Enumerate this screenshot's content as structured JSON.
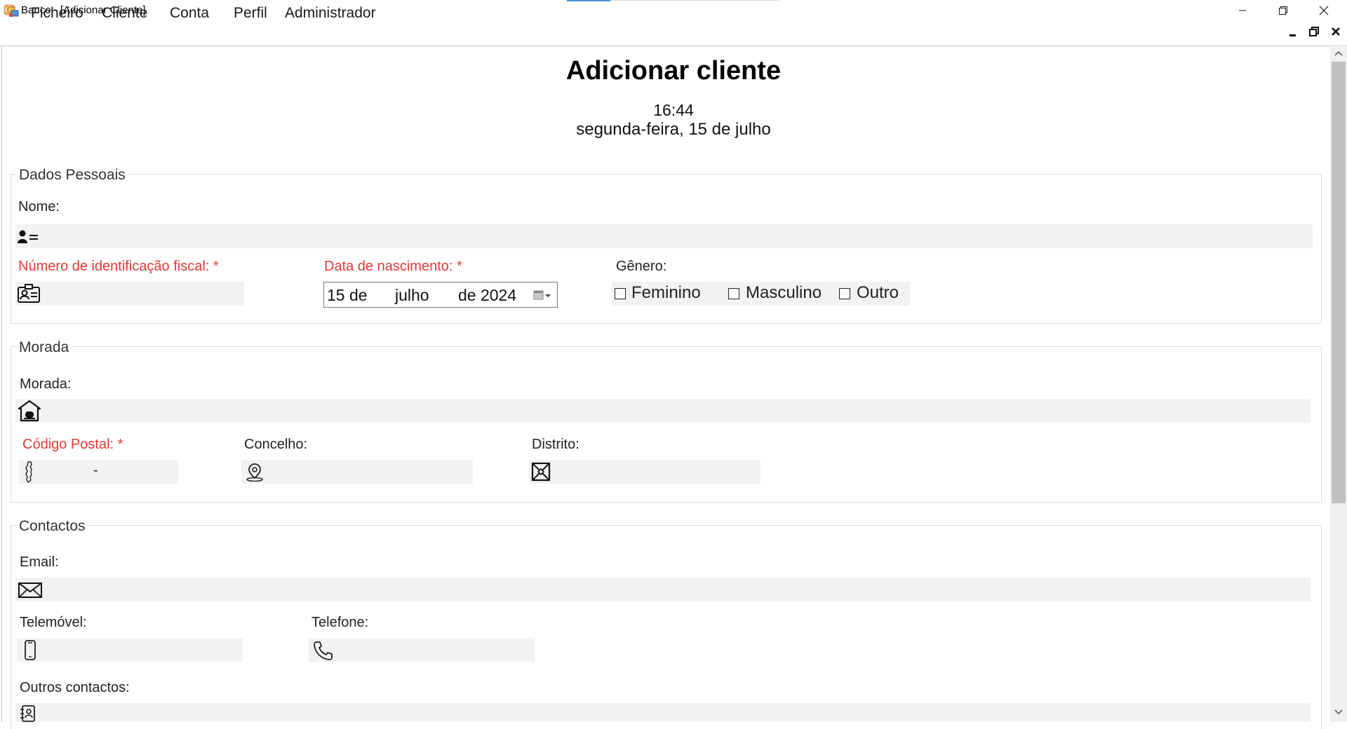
{
  "window": {
    "title": "Banco - [Adicionar Cliente]",
    "controls": [
      "minimize-icon",
      "restore-icon",
      "close-icon"
    ]
  },
  "menu": {
    "items": [
      "Ficheiro",
      "Cliente",
      "Conta",
      "Perfil",
      "Administrador"
    ],
    "mdi_controls": [
      "minimize-icon",
      "restore-icon",
      "close-icon"
    ]
  },
  "header": {
    "title": "Adicionar cliente",
    "time": "16:44",
    "date": "segunda-feira, 15 de julho"
  },
  "dados_pessoais": {
    "legend": "Dados Pessoais",
    "nome_label": "Nome:",
    "nome_value": "",
    "nif_label": "Número de identificação fiscal: *",
    "nif_value": "",
    "dob_label": "Data de nascimento: *",
    "dob_day": "15 de",
    "dob_month": "julho",
    "dob_year": "de 2024",
    "genero_label": "Gênero:",
    "genero_options": [
      "Feminino",
      "Masculino",
      "Outro"
    ]
  },
  "morada": {
    "legend": "Morada",
    "morada_label": "Morada:",
    "morada_value": "",
    "codigo_postal_label": "Código Postal: *",
    "codigo_postal_sep": "-",
    "concelho_label": "Concelho:",
    "concelho_value": "",
    "distrito_label": "Distrito:",
    "distrito_value": ""
  },
  "contactos": {
    "legend": "Contactos",
    "email_label": "Email:",
    "email_value": "",
    "telemovel_label": "Telemóvel:",
    "telemovel_value": "",
    "telefone_label": "Telefone:",
    "telefone_value": "",
    "outros_label": "Outros contactos:",
    "outros_value": ""
  },
  "colors": {
    "required": "#e53935",
    "field_bg": "#f2f2f2",
    "accent": "#4a8fd6"
  }
}
